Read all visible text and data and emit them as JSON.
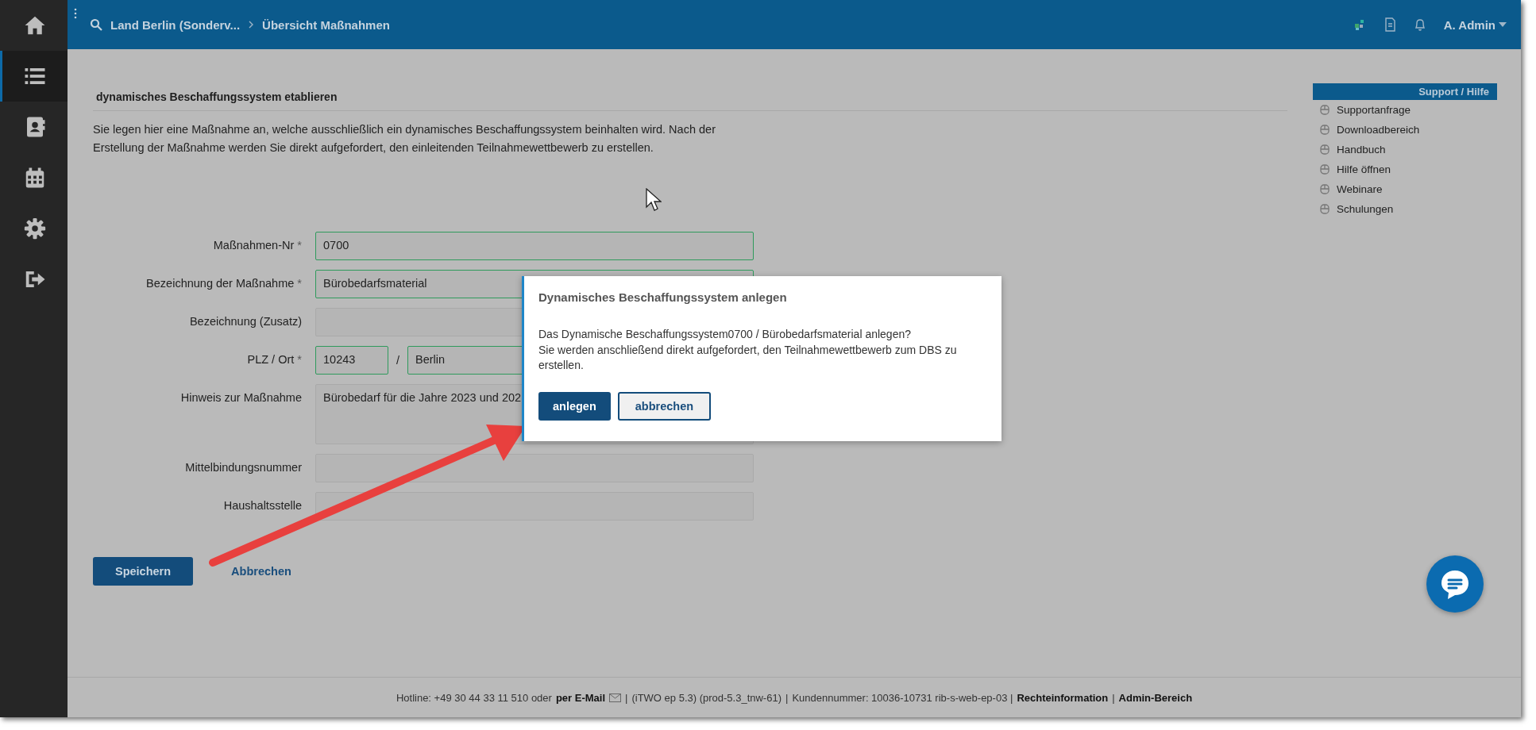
{
  "sidebar": {
    "items": [
      {
        "kind": "home",
        "selected": false
      },
      {
        "kind": "list",
        "selected": true
      },
      {
        "kind": "contacts",
        "selected": false
      },
      {
        "kind": "calendar",
        "selected": false
      },
      {
        "kind": "settings",
        "selected": false
      },
      {
        "kind": "logout",
        "selected": false
      }
    ]
  },
  "topbar": {
    "breadcrumbs": [
      "Land Berlin (Sonderv...",
      "Übersicht Maßnahmen"
    ],
    "user": "A. Admin"
  },
  "page": {
    "title": "dynamisches Beschaffungssystem etablieren",
    "description": "Sie legen hier eine Maßnahme an, welche ausschließlich ein dynamisches Beschaffungssystem beinhalten wird. Nach der Erstellung der Maßnahme werden Sie direkt aufgefordert, den einleitenden Teilnahmewettbewerb zu erstellen."
  },
  "form": {
    "fields": [
      {
        "kind": "text",
        "label": "Maßnahmen-Nr",
        "required_mark": "*",
        "value": "0700",
        "valid": true
      },
      {
        "kind": "text",
        "label": "Bezeichnung der Maßnahme",
        "required_mark": "*",
        "value": "Bürobedarfsmaterial",
        "valid": true
      },
      {
        "kind": "text",
        "label": "Bezeichnung (Zusatz)",
        "valid": false
      },
      {
        "kind": "plz",
        "label": "PLZ / Ort",
        "required_mark": "*",
        "value": "10243",
        "separator": "/",
        "value2": "Berlin",
        "valid": true
      },
      {
        "kind": "textarea",
        "label": "Hinweis zur Maßnahme",
        "value": "Bürobedarf für die Jahre 2023 und 202",
        "valid": false
      },
      {
        "kind": "text",
        "label": "Mittelbindungsnummer",
        "valid": false
      },
      {
        "kind": "text",
        "label": "Haushaltsstelle",
        "valid": false
      }
    ],
    "save": "Speichern",
    "cancel": "Abbrechen"
  },
  "support": {
    "title": "Support / Hilfe",
    "items": [
      "Supportanfrage",
      "Downloadbereich",
      "Handbuch",
      "Hilfe öffnen",
      "Webinare",
      "Schulungen"
    ]
  },
  "dialog": {
    "title": "Dynamisches Beschaffungssystem anlegen",
    "lines": [
      "Das Dynamische Beschaffungssystem0700 / Bürobedarfsmaterial anlegen?",
      "Sie werden anschließend direkt aufgefordert, den Teilnahmewettbewerb zum DBS zu erstellen."
    ],
    "confirm": "anlegen",
    "cancel": "abbrechen"
  },
  "footer": {
    "hotline": "Hotline: +49 30 44 33 11 510 oder",
    "email": "per E-Mail",
    "sep": "|",
    "version": "(iTWO ep 5.3) (prod-5.3_tnw-61)",
    "customer": "Kundennummer: 10036-10731 rib-s-web-ep-03 |",
    "legal": "Rechteinformation",
    "admin": "Admin-Bereich"
  }
}
